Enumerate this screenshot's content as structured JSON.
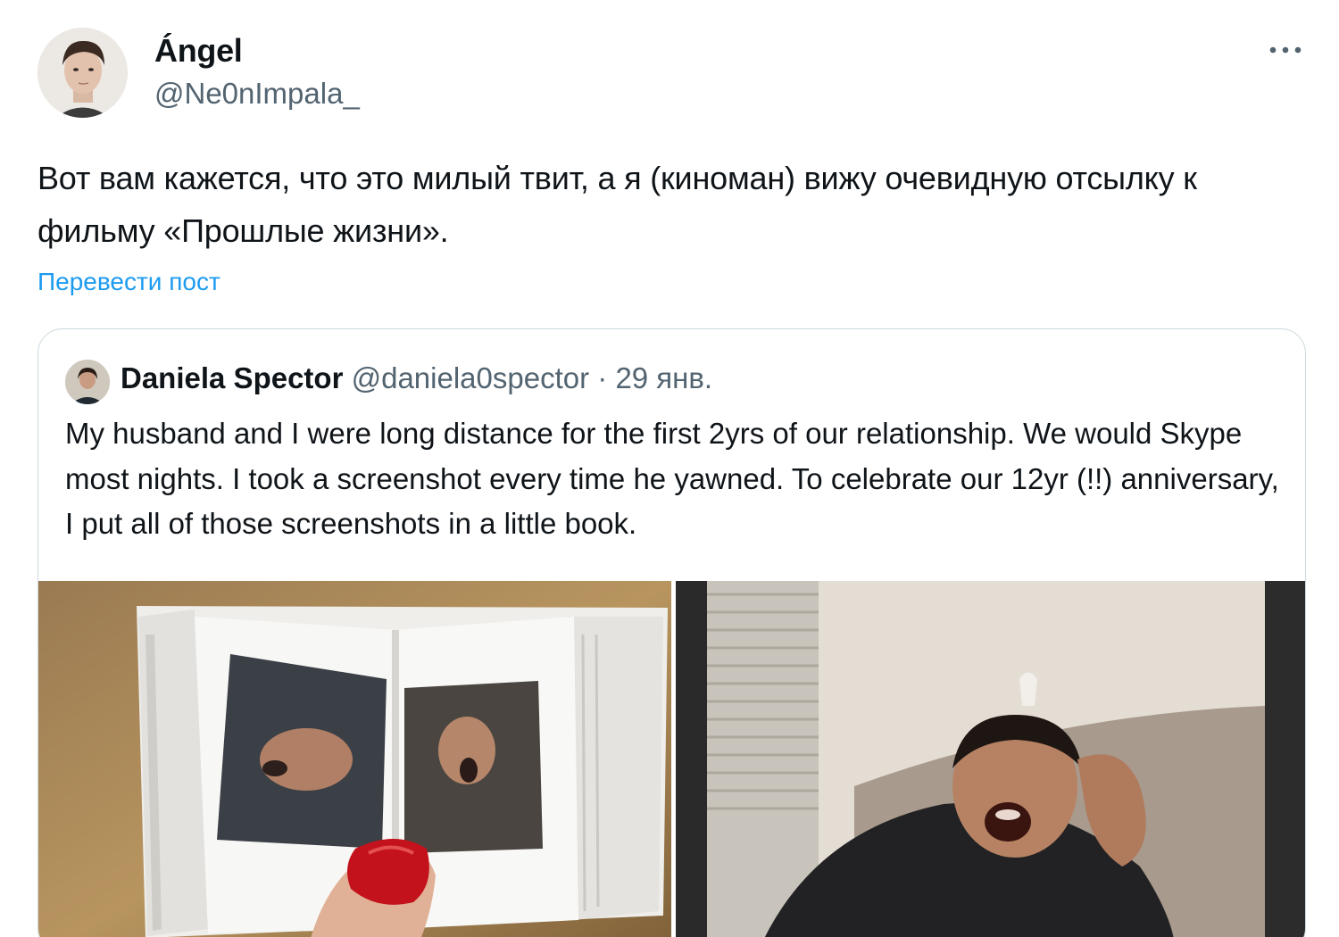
{
  "author": {
    "name": "Ángel",
    "handle": "@Ne0nImpala_"
  },
  "tweet": {
    "text": "Вот вам кажется, что это милый твит, а я (киноман) вижу очевидную отсылку к фильму «Прошлые жизни».",
    "translate_label": "Перевести пост"
  },
  "quoted": {
    "name": "Daniela Spector",
    "handle": "@daniela0spector",
    "separator": "·",
    "date": "29 янв.",
    "text": "My husband and I were long distance for the first 2yrs of our relationship. We would Skype most nights. I took a screenshot every time he yawned. To celebrate our 12yr (!!) anniversary, I put all of those screenshots in a little book."
  },
  "icons": {
    "more": "more-horizontal-icon"
  },
  "colors": {
    "link": "#1d9bf0",
    "secondary_text": "#536471",
    "border": "#cfd9de"
  }
}
